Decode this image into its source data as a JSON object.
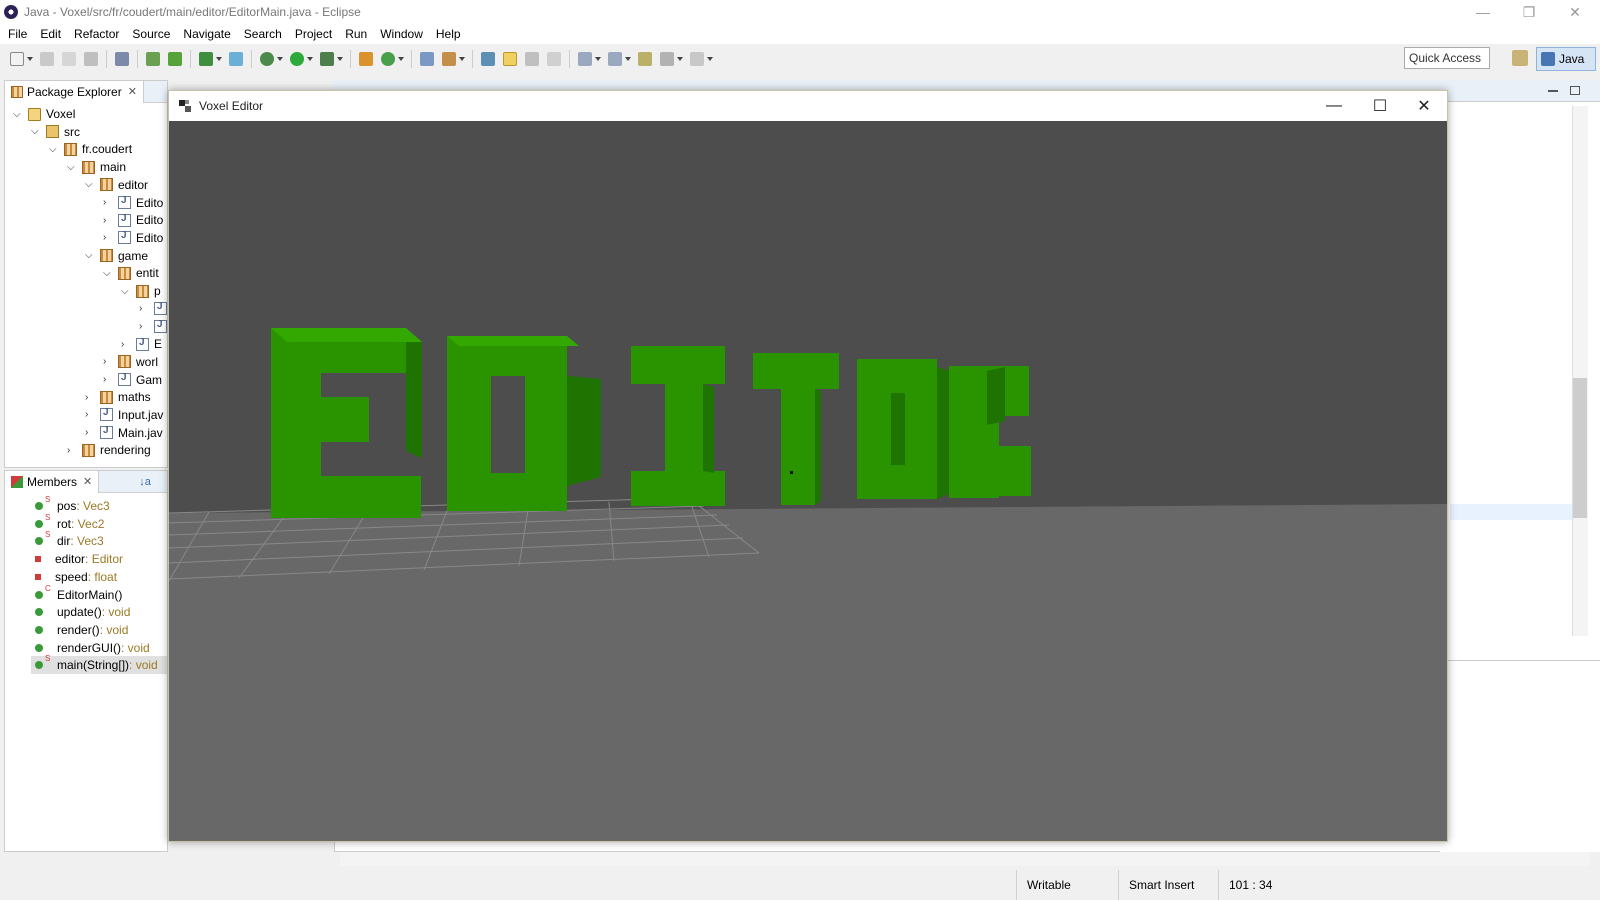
{
  "eclipse": {
    "window_title": "Java - Voxel/src/fr/coudert/main/editor/EditorMain.java - Eclipse",
    "minimize_glyph": "—",
    "restore_glyph": "❐",
    "close_glyph": "✕"
  },
  "menubar": {
    "items": [
      "File",
      "Edit",
      "Refactor",
      "Source",
      "Navigate",
      "Search",
      "Project",
      "Run",
      "Window",
      "Help"
    ]
  },
  "toolbar": {
    "quick_access_placeholder": "Quick Access",
    "perspective_label": "Java"
  },
  "package_explorer": {
    "tab_label": "Package Explorer",
    "tree": [
      {
        "label": "Voxel",
        "icon": "project-icon",
        "expanded": true
      },
      {
        "label": "src",
        "icon": "source-folder-icon",
        "expanded": true
      },
      {
        "label": "fr.coudert",
        "icon": "package-icon",
        "expanded": true
      },
      {
        "label": "main",
        "icon": "package-icon",
        "expanded": true
      },
      {
        "label": "editor",
        "icon": "package-icon",
        "expanded": true
      },
      {
        "label": "Edito",
        "icon": "java-file-icon",
        "expanded": false
      },
      {
        "label": "Edito",
        "icon": "java-file-icon",
        "expanded": false
      },
      {
        "label": "Edito",
        "icon": "java-file-icon",
        "expanded": false
      },
      {
        "label": "game",
        "icon": "package-icon",
        "expanded": true
      },
      {
        "label": "entit",
        "icon": "package-icon",
        "expanded": true
      },
      {
        "label": "p",
        "icon": "package-icon",
        "expanded": true
      },
      {
        "label": "[",
        "icon": "java-file-icon",
        "expanded": false
      },
      {
        "label": "[",
        "icon": "java-file-icon",
        "expanded": false
      },
      {
        "label": "E",
        "icon": "java-file-icon",
        "expanded": false
      },
      {
        "label": "worl",
        "icon": "package-icon",
        "expanded": false
      },
      {
        "label": "Gam",
        "icon": "java-file-icon",
        "expanded": false
      },
      {
        "label": "maths",
        "icon": "package-icon",
        "expanded": false
      },
      {
        "label": "Input.jav",
        "icon": "java-file-icon",
        "expanded": false
      },
      {
        "label": "Main.jav",
        "icon": "java-file-icon",
        "expanded": false
      },
      {
        "label": "rendering",
        "icon": "package-icon",
        "expanded": false
      }
    ]
  },
  "members": {
    "tab_label": "Members",
    "items": [
      {
        "name": "pos",
        "type": "Vec3",
        "visibility": "public",
        "static": true
      },
      {
        "name": "rot",
        "type": "Vec2",
        "visibility": "public",
        "static": true
      },
      {
        "name": "dir",
        "type": "Vec3",
        "visibility": "public",
        "static": true
      },
      {
        "name": "editor",
        "type": "Editor",
        "visibility": "private",
        "static": false
      },
      {
        "name": "speed",
        "type": "float",
        "visibility": "private",
        "static": false
      },
      {
        "name": "EditorMain()",
        "type": "",
        "visibility": "public",
        "static": false,
        "constructor": true
      },
      {
        "name": "update()",
        "type": "void",
        "visibility": "public",
        "static": false
      },
      {
        "name": "render()",
        "type": "void",
        "visibility": "public",
        "static": false
      },
      {
        "name": "renderGUI()",
        "type": "void",
        "visibility": "public",
        "static": false
      },
      {
        "name": "main(String[])",
        "type": "void",
        "visibility": "public",
        "static": true,
        "selected": true
      }
    ]
  },
  "voxel_window": {
    "title": "Voxel Editor",
    "minimize_glyph": "—",
    "maximize_glyph": "☐",
    "close_glyph": "✕",
    "scene_text": "EDITOR",
    "colors": {
      "sky": "#4d4d4d",
      "ground": "#686868",
      "voxel_front": "#2a9400",
      "voxel_side": "#1f7300",
      "voxel_top": "#33a800",
      "grid": "#888888"
    }
  },
  "statusbar": {
    "writable": "Writable",
    "insert_mode": "Smart Insert",
    "position": "101 : 34"
  }
}
